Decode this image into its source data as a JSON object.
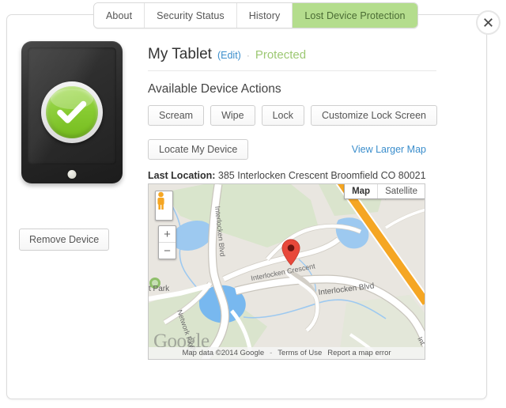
{
  "window": {
    "close_label": "✕"
  },
  "tabs": [
    {
      "label": "About",
      "active": false
    },
    {
      "label": "Security Status",
      "active": false
    },
    {
      "label": "History",
      "active": false
    },
    {
      "label": "Lost Device Protection",
      "active": true
    }
  ],
  "device": {
    "name": "My Tablet",
    "edit_label": "(Edit)",
    "separator": "·",
    "status": "Protected",
    "remove_label": "Remove Device",
    "icon": "tablet-protected-check"
  },
  "actions": {
    "heading": "Available Device Actions",
    "buttons": [
      {
        "label": "Scream"
      },
      {
        "label": "Wipe"
      },
      {
        "label": "Lock"
      },
      {
        "label": "Customize Lock Screen"
      }
    ]
  },
  "locate": {
    "button_label": "Locate My Device",
    "view_larger_map_label": "View Larger Map",
    "last_location_label": "Last Location:",
    "last_location_value": "385 Interlocken Crescent Broomfield CO 80021"
  },
  "map": {
    "pegman_label": "Street View pegman",
    "zoom_in_label": "+",
    "zoom_out_label": "−",
    "types": [
      {
        "label": "Map",
        "selected": true
      },
      {
        "label": "Satellite",
        "selected": false
      }
    ],
    "marker_label": "Device location marker",
    "watermark": "Google",
    "attribution": "Map data ©2014 Google",
    "separator": "-",
    "terms_label": "Terms of Use",
    "report_label": "Report a map error",
    "street_labels": [
      "Interlocken Blvd",
      "Interlocken Crescent",
      "Interlocken Blvd",
      "Network Pkwy",
      "t Park"
    ]
  },
  "colors": {
    "tab_active_bg": "#b4dd8d",
    "tab_active_text": "#4a6b34",
    "link": "#3b8ecc",
    "protected_green": "#9dc873",
    "badge_green": "#88cc32",
    "marker_red": "#e8483a",
    "highway_orange": "#f5a623"
  }
}
